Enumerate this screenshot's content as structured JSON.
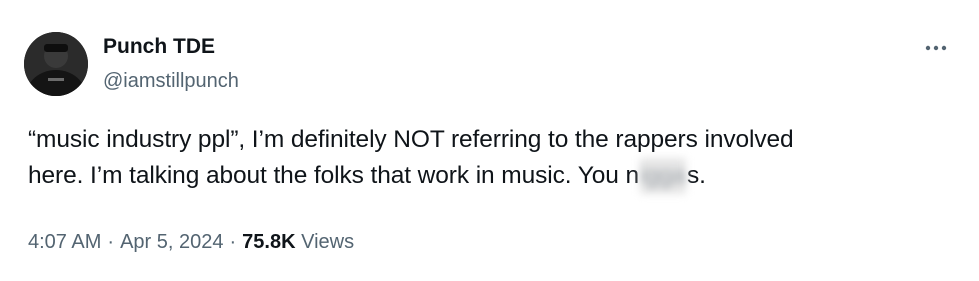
{
  "author": {
    "display_name": "Punch TDE",
    "handle": "@iamstillpunch",
    "avatar_icon": "profile-photo"
  },
  "menu": {
    "icon": "more-options-icon"
  },
  "tweet": {
    "line1": "“music industry ppl”, I’m definitely NOT referring to the rappers involved",
    "line2_before": "here. I’m talking about the folks that work in music. You n",
    "line2_obscured": "igga",
    "line2_after": "s."
  },
  "meta": {
    "time": "4:07 AM",
    "date": "Apr 5, 2024",
    "separator": "·",
    "view_count": "75.8K",
    "views_label": "Views"
  },
  "colors": {
    "text_primary": "#0f1419",
    "text_secondary": "#536471",
    "background": "#ffffff"
  }
}
